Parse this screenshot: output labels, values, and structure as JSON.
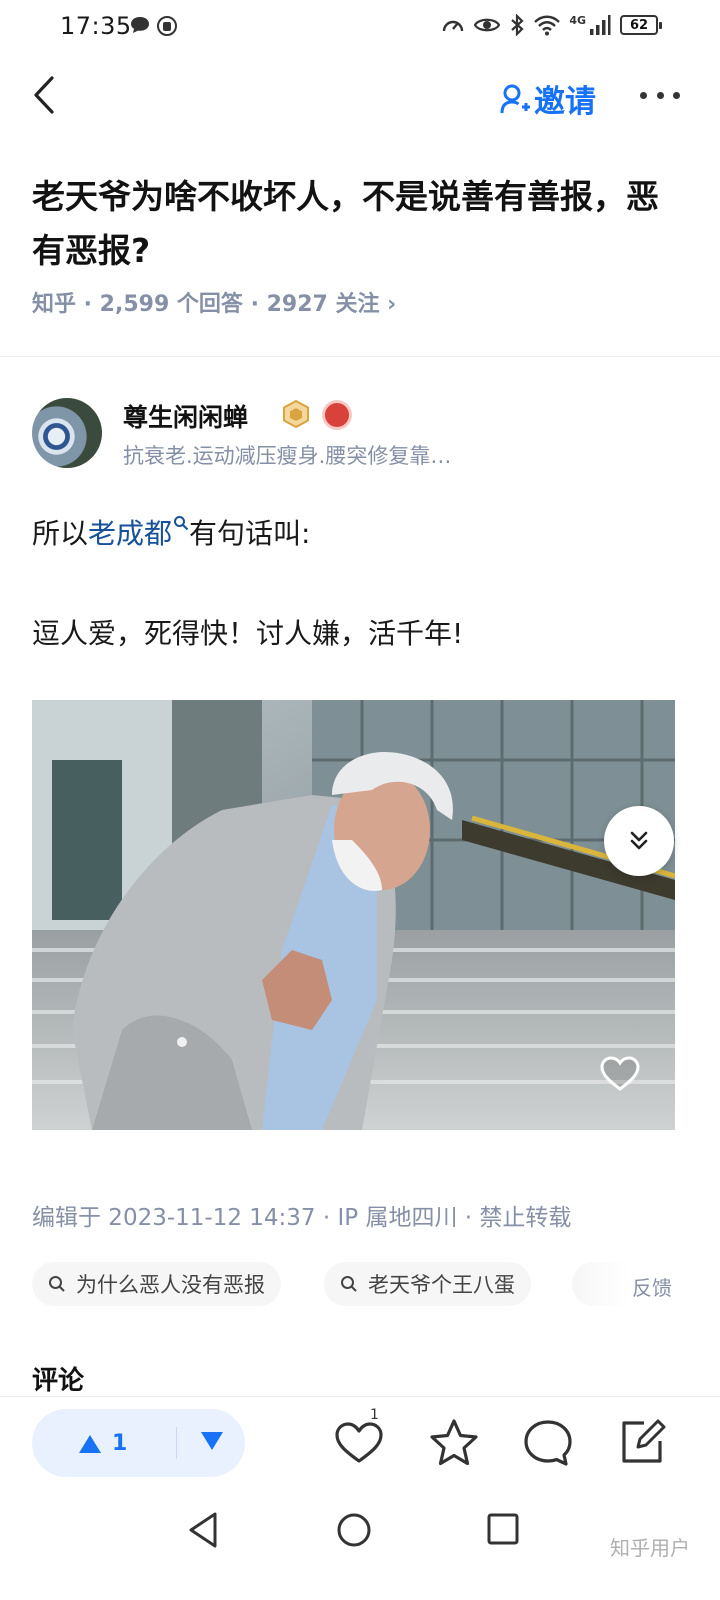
{
  "status_bar": {
    "time": "17:35",
    "battery": "62",
    "network": "4G",
    "icons": [
      "chat-bubble-icon",
      "hand-icon",
      "speed-icon",
      "eye-icon",
      "bluetooth-icon",
      "wifi-icon",
      "signal-icon",
      "battery-icon"
    ]
  },
  "nav": {
    "back_icon": "chevron-left-icon",
    "invite_label": "邀请",
    "invite_icon": "add-user-icon",
    "more_icon": "more-dots-icon"
  },
  "question": {
    "title": "老天爷为啥不收坏人，不是说善有善报，恶有恶报?",
    "meta": "知乎 · 2,599 个回答 · 2927 关注 ›"
  },
  "author": {
    "name": "尊生闲闲蝉",
    "bio": "抗衰老.运动减压瘦身.腰突修复靠…"
  },
  "content": {
    "para1_prefix": "所以",
    "para1_link": "老成都",
    "para1_suffix": "有句话叫:",
    "para2": "逗人爱，死得快！讨人嫌，活千年!"
  },
  "edit_info": "编辑于 2023-11-12 14:37 · IP 属地四川 · 禁止转载",
  "tags": [
    {
      "label": "为什么恶人没有恶报"
    },
    {
      "label": "老天爷个王八蛋"
    }
  ],
  "feedback_label": "反馈",
  "comments_heading": "评论",
  "actions": {
    "upvote_count": "1",
    "like_count": "1",
    "icons": [
      "upvote-icon",
      "downvote-icon",
      "heart-icon",
      "star-icon",
      "comment-icon",
      "edit-icon"
    ]
  },
  "system_nav": {
    "icons": [
      "nav-back-icon",
      "nav-home-icon",
      "nav-recents-icon"
    ]
  },
  "watermark": "知乎用户",
  "colors": {
    "accent": "#1772f6",
    "link": "#175199",
    "meta_gray": "#8590a6"
  }
}
